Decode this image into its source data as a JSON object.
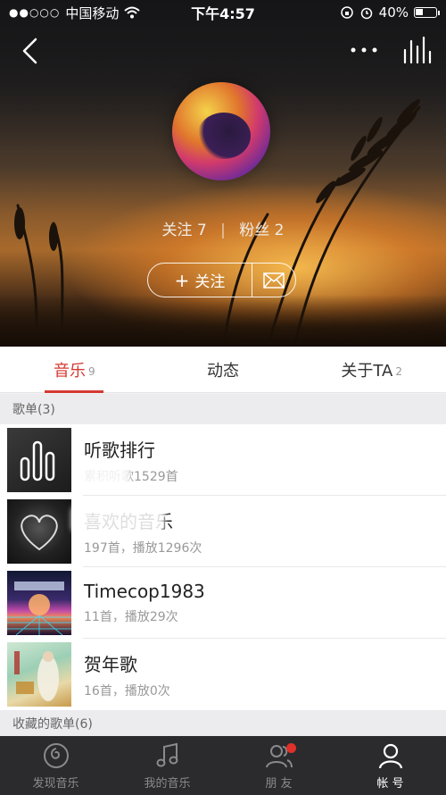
{
  "status_bar": {
    "signal": "●●○○○",
    "carrier": "中国移动",
    "time": "下午4:57",
    "battery": "40%",
    "battery_level": 0.4
  },
  "profile": {
    "follow_label": "关注 7",
    "fans_label": "粉丝 2",
    "separator": "|",
    "follow_button": "关注",
    "follow_plus": "+"
  },
  "tabs": [
    {
      "label": "音乐",
      "count": "9",
      "active": true
    },
    {
      "label": "动态",
      "count": "",
      "active": false
    },
    {
      "label": "关于TA",
      "count": "2",
      "active": false
    }
  ],
  "sections": {
    "playlists_header": "歌单(3)",
    "collected_header": "收藏的歌单(6)"
  },
  "playlists": [
    {
      "title": "听歌排行",
      "meta": "累积听歌1529首"
    },
    {
      "title": "喜欢的音乐",
      "meta": "197首，播放1296次"
    },
    {
      "title": "Timecop1983",
      "meta": "11首，播放29次"
    },
    {
      "title": "贺年歌",
      "meta": "16首，播放0次"
    }
  ],
  "bottom_nav": [
    {
      "label": "发现音乐",
      "icon": "netease-logo-icon",
      "active": false
    },
    {
      "label": "我的音乐",
      "icon": "music-note-icon",
      "active": false
    },
    {
      "label": "朋 友",
      "icon": "friends-icon",
      "active": false,
      "badge": true
    },
    {
      "label": "帐 号",
      "icon": "person-icon",
      "active": true
    }
  ],
  "colors": {
    "accent_red": "#d33a31",
    "nav_bg": "#2b2b2e"
  }
}
